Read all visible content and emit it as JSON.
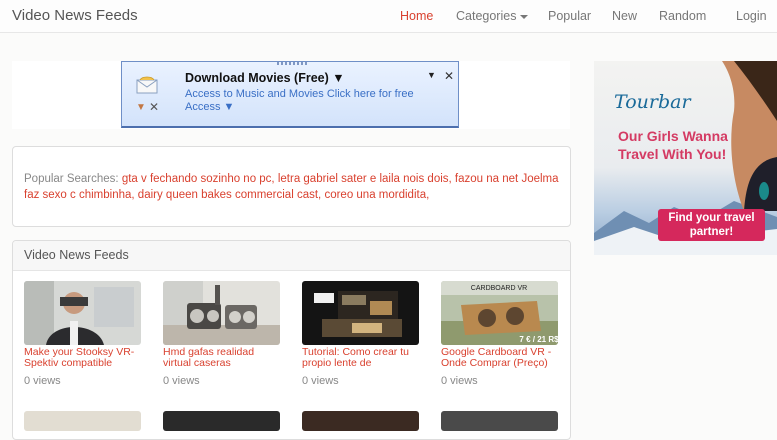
{
  "nav": {
    "brand": "Video News Feeds",
    "items": [
      "Home",
      "Categories",
      "Popular",
      "New",
      "Random",
      "Login"
    ]
  },
  "download_ad": {
    "title": "Download Movies (Free) ▼",
    "text": "Access to Music and Movies Click here for free Access ▼",
    "menu_glyph": "▼",
    "close_glyph": "✕"
  },
  "popular": {
    "label": "Popular Searches:",
    "links": [
      "gta v fechando sozinho no pc,",
      "letra gabriel sater e laila nois dois,",
      "fazou na net",
      "Joelma faz sexo c chimbinha,",
      "dairy queen bakes commercial cast,",
      "coreo una mordidita,"
    ]
  },
  "videos": {
    "heading": "Video News Feeds",
    "items": [
      {
        "title": "Make your Stooksy VR-Spektiv compatible",
        "views": "0 views"
      },
      {
        "title": "Hmd gafas realidad virtual caseras",
        "views": "0 views"
      },
      {
        "title": "Tutorial: Como crear tu propio lente de",
        "views": "0 views"
      },
      {
        "title": "Google Cardboard VR - Onde Comprar (Preço)",
        "views": "0 views"
      }
    ],
    "thumb_overlays": {
      "cardboard_caption": "CARDBOARD VR",
      "price": "7 € / 21 R$"
    }
  },
  "tour_ad": {
    "logo": "Tourbar",
    "headline": "Our Girls Wanna Travel With You!",
    "cta": "Find your travel partner!"
  },
  "colors": {
    "accent": "#d9412f",
    "ad_pink": "#d5285c",
    "ad_blue": "#1a6a99"
  }
}
